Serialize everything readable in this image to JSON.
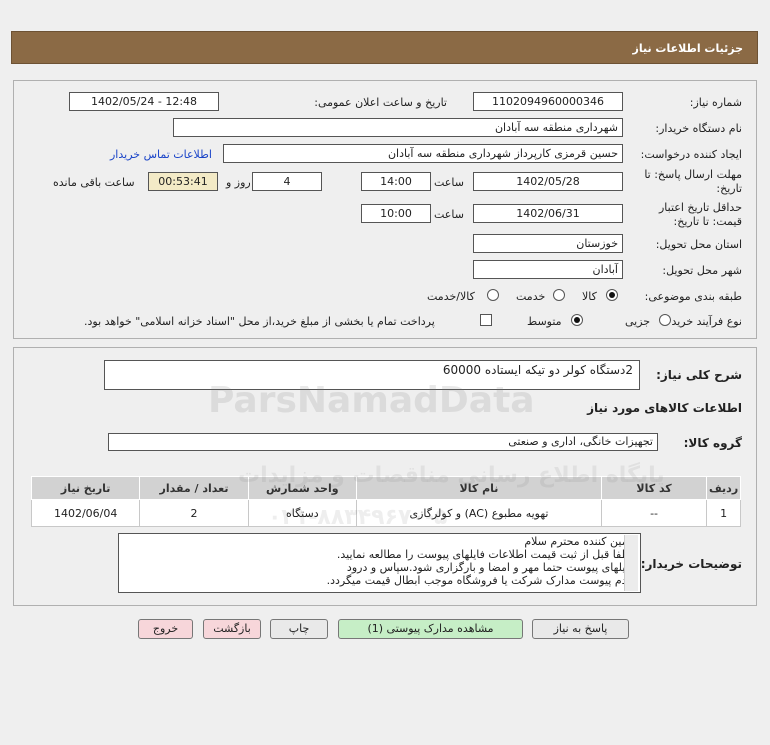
{
  "title": "جزئیات اطلاعات نیاز",
  "form": {
    "need_number_label": "شماره نیاز:",
    "need_number": "1102094960000346",
    "announce_label": "تاریخ و ساعت اعلان عمومی:",
    "announce_value": "1402/05/24 - 12:48",
    "buyer_org_label": "نام دستگاه خریدار:",
    "buyer_org": "شهرداری منطقه سه آبادان",
    "requester_label": "ایجاد کننده درخواست:",
    "requester": "حسین قرمزی کارپرداز شهرداری منطقه سه آبادان",
    "contact_link": "اطلاعات تماس خریدار",
    "deadline_label_1": "مهلت ارسال پاسخ: تا",
    "deadline_label_2": "تاریخ:",
    "deadline_date": "1402/05/28",
    "time_label": "ساعت",
    "deadline_time": "14:00",
    "days_value": "4",
    "days_label": "روز و",
    "remaining_value": "00:53:41",
    "remaining_label": "ساعت باقی مانده",
    "validity_label_1": "حداقل تاریخ اعتبار",
    "validity_label_2": "قیمت: تا تاریخ:",
    "validity_date": "1402/06/31",
    "validity_time_label": "ساعت",
    "validity_time": "10:00",
    "province_label": "استان محل تحویل:",
    "province": "خوزستان",
    "city_label": "شهر محل تحویل:",
    "city": "آبادان",
    "category_label": "طبقه بندی موضوعی:",
    "category_options": [
      "کالا",
      "خدمت",
      "کالا/خدمت"
    ],
    "process_label": "نوع فرآیند خرید :",
    "process_options": [
      "جزیی",
      "متوسط"
    ],
    "payment_note": "پرداخت تمام یا بخشی از مبلغ خرید،از محل \"اسناد خزانه اسلامی\" خواهد بود."
  },
  "summary": {
    "desc_label": "شرح کلی نیاز:",
    "desc_value": "2دستگاه کولر دو تیکه ایستاده 60000",
    "goods_header": "اطلاعات کالاهای مورد نیاز",
    "group_label": "گروه کالا:",
    "group_value": "تجهیزات خانگی، اداری و صنعتی"
  },
  "table": {
    "headers": [
      "ردیف",
      "کد کالا",
      "نام کالا",
      "واحد شمارش",
      "تعداد / مقدار",
      "تاریخ نیاز"
    ],
    "rows": [
      [
        "1",
        "--",
        "تهویه مطبوع (AC) و کولرگازی",
        "دستگاه",
        "2",
        "1402/06/04"
      ]
    ]
  },
  "notes": {
    "label": "توضیحات خریدار:",
    "lines": [
      "تامین کننده محترم سلام",
      "لطفا قبل از ثبت قیمت اطلاعات فایلهای پیوست را مطالعه نمایید.",
      "فایلهای پیوست حتما مهر و امضا و بارگزاری شود.سپاس و درود",
      "عدم پیوست مدارک شرکت یا فروشگاه موجب ابطال قیمت میگردد."
    ]
  },
  "buttons": {
    "reply": "پاسخ به نیاز",
    "view_docs": "مشاهده مدارک پیوستی (1)",
    "print": "چاپ",
    "back": "بازگشت",
    "exit": "خروج"
  },
  "watermark": {
    "brand": "ParsNamadData",
    "line1": "پایگاه اطلاع رسانی مناقصات و مزایدات",
    "line2": "۰۲۱-۸۸۳۴۹۶۷۰-۵"
  },
  "colors": {
    "title_bar": "#8b6a45",
    "table_header": "#d2d2d2",
    "link": "#1a44c8",
    "button_green": "#c6eec6",
    "button_pink": "#f7d6da"
  }
}
